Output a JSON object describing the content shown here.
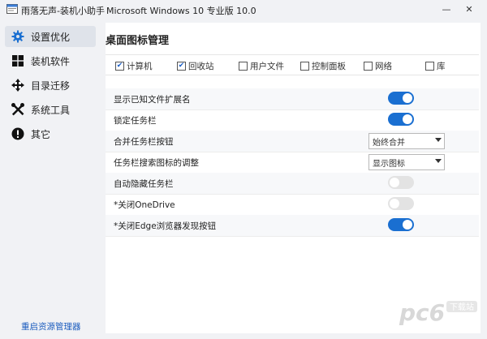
{
  "app": {
    "title": "雨落无声-装机小助手",
    "os_info": "Microsoft Windows 10 专业版 10.0"
  },
  "window_controls": {
    "minimize": "—",
    "close": "✕"
  },
  "sidebar": {
    "items": [
      {
        "label": "设置优化",
        "icon": "gear-icon",
        "active": true
      },
      {
        "label": "装机软件",
        "icon": "windows-icon",
        "active": false
      },
      {
        "label": "目录迁移",
        "icon": "move-arrows-icon",
        "active": false
      },
      {
        "label": "系统工具",
        "icon": "tools-icon",
        "active": false
      },
      {
        "label": "其它",
        "icon": "exclamation-icon",
        "active": false
      }
    ],
    "restart_link": "重启资源管理器"
  },
  "main": {
    "section_title": "桌面图标管理",
    "desktop_icons": [
      {
        "label": "计算机",
        "checked": true
      },
      {
        "label": "回收站",
        "checked": true
      },
      {
        "label": "用户文件",
        "checked": false
      },
      {
        "label": "控制面板",
        "checked": false
      },
      {
        "label": "网络",
        "checked": false
      },
      {
        "label": "库",
        "checked": false
      }
    ],
    "settings": [
      {
        "label": "显示已知文件扩展名",
        "control": "toggle",
        "on": true
      },
      {
        "label": "锁定任务栏",
        "control": "toggle",
        "on": true
      },
      {
        "label": "合并任务栏按钮",
        "control": "select",
        "value": "始终合并"
      },
      {
        "label": "任务栏搜索图标的调整",
        "control": "select",
        "value": "显示图标"
      },
      {
        "label": "自动隐藏任务栏",
        "control": "toggle",
        "on": false
      },
      {
        "label": "*关闭OneDrive",
        "control": "toggle",
        "on": false
      },
      {
        "label": "*关闭Edge浏览器发现按钮",
        "control": "toggle",
        "on": true
      }
    ]
  },
  "watermark": {
    "text": "pc6",
    "sub": "下载站"
  },
  "colors": {
    "accent": "#1a6fd1",
    "link": "#1f5fbf",
    "sidebar_bg": "#f1f2f5",
    "active_bg": "#dfe3ea"
  }
}
